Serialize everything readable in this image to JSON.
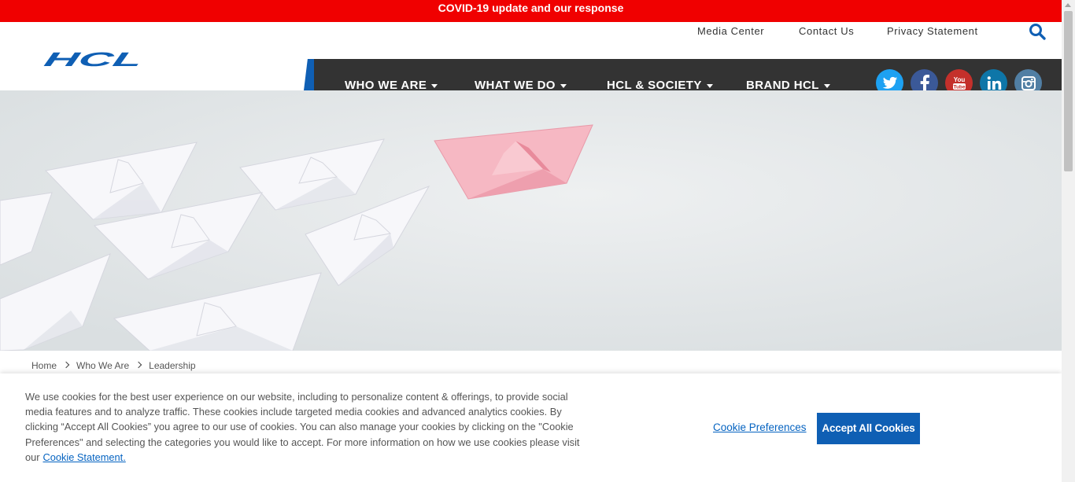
{
  "covid_banner": "COVID-19 update and our response",
  "utility_links": [
    "Media Center",
    "Contact Us",
    "Privacy Statement"
  ],
  "logo_text": "HCL",
  "nav": {
    "items": [
      "WHO WE ARE",
      "WHAT WE DO",
      "HCL & SOCIETY",
      "BRAND HCL"
    ]
  },
  "social": [
    {
      "name": "twitter-icon",
      "color": "#1da1f2"
    },
    {
      "name": "facebook-icon",
      "color": "#3b5998"
    },
    {
      "name": "youtube-icon",
      "color": "#c4302b"
    },
    {
      "name": "linkedin-icon",
      "color": "#0e76a8"
    },
    {
      "name": "instagram-icon",
      "color": "#517fa4"
    }
  ],
  "breadcrumb": [
    "Home",
    "Who We Are",
    "Leadership"
  ],
  "cookie": {
    "text": "We use cookies for the best user experience on our website, including to personalize content & offerings, to provide social media features and to analyze traffic. These cookies include targeted media cookies and advanced analytics cookies. By clicking “Accept All Cookies” you agree to our use of cookies. You can also manage your cookies by clicking on the \"Cookie Preferences\" and selecting the categories you would like to accept. For more information on how we use cookies please visit our",
    "statement_link": "Cookie Statement.",
    "preferences_link": "Cookie Preferences",
    "accept_button": "Accept All Cookies"
  },
  "colors": {
    "covid_red": "#f00000",
    "brand_blue": "#0f5fb4",
    "nav_bg": "#333333",
    "link_blue": "#0563c1"
  }
}
